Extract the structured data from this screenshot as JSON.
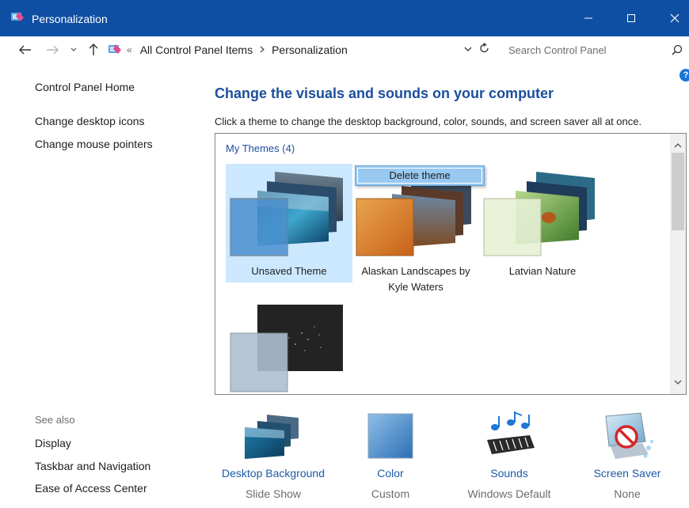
{
  "window": {
    "title": "Personalization",
    "accent": "#0f4fa3"
  },
  "address": {
    "crumb_overflow": "«",
    "crumbs": [
      "All Control Panel Items",
      "Personalization"
    ],
    "search_placeholder": "Search Control Panel"
  },
  "sidebar": {
    "home": "Control Panel Home",
    "links": [
      "Change desktop icons",
      "Change mouse pointers"
    ],
    "see_also_label": "See also",
    "see_also": [
      "Display",
      "Taskbar and Navigation",
      "Ease of Access Center"
    ]
  },
  "main": {
    "heading": "Change the visuals and sounds on your computer",
    "subtext": "Click a theme to change the desktop background, color, sounds, and screen saver all at once.",
    "group_title": "My Themes (4)",
    "context_menu_item": "Delete theme",
    "themes": [
      {
        "name": "Unsaved Theme",
        "selected": true
      },
      {
        "name_line1": "Alaskan Landscapes by",
        "name_line2": "Kyle Waters",
        "selected": false
      },
      {
        "name": "Latvian Nature",
        "selected": false
      },
      {
        "name": "",
        "selected": false
      }
    ]
  },
  "bottom": [
    {
      "name": "Desktop Background",
      "value": "Slide Show",
      "icon": "desktop-background-icon"
    },
    {
      "name": "Color",
      "value": "Custom",
      "icon": "color-icon"
    },
    {
      "name": "Sounds",
      "value": "Windows Default",
      "icon": "sounds-icon"
    },
    {
      "name": "Screen Saver",
      "value": "None",
      "icon": "screen-saver-icon"
    }
  ]
}
